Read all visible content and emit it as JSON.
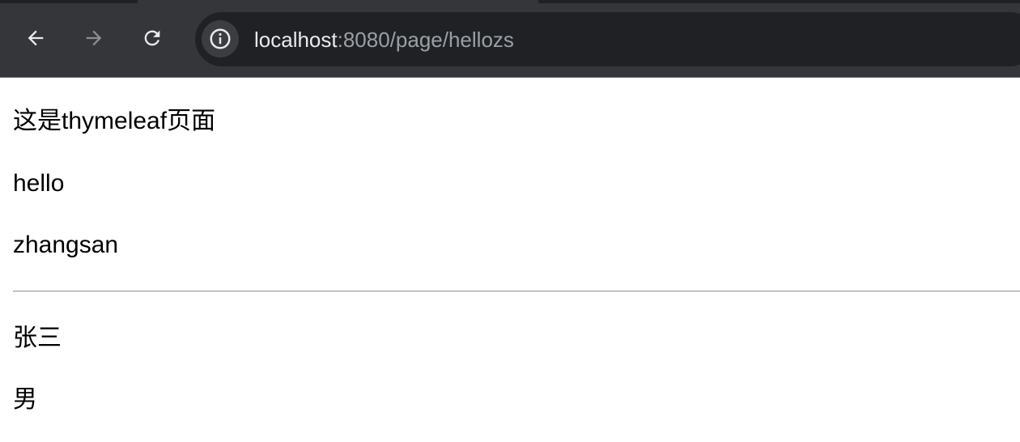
{
  "browser": {
    "url_host": "localhost",
    "url_path": ":8080/page/hellozs",
    "icons": {
      "back": "arrow-left-icon",
      "forward": "arrow-right-icon",
      "reload": "reload-icon",
      "site_info": "info-icon"
    },
    "colors": {
      "toolbar": "#35363a",
      "omnibox": "#202124",
      "host_text": "#e8eaed",
      "path_text": "#9aa0a6"
    }
  },
  "page": {
    "line1": "这是thymeleaf页面",
    "line2": "hello",
    "line3": "zhangsan",
    "line4": "张三",
    "line5": "男"
  }
}
